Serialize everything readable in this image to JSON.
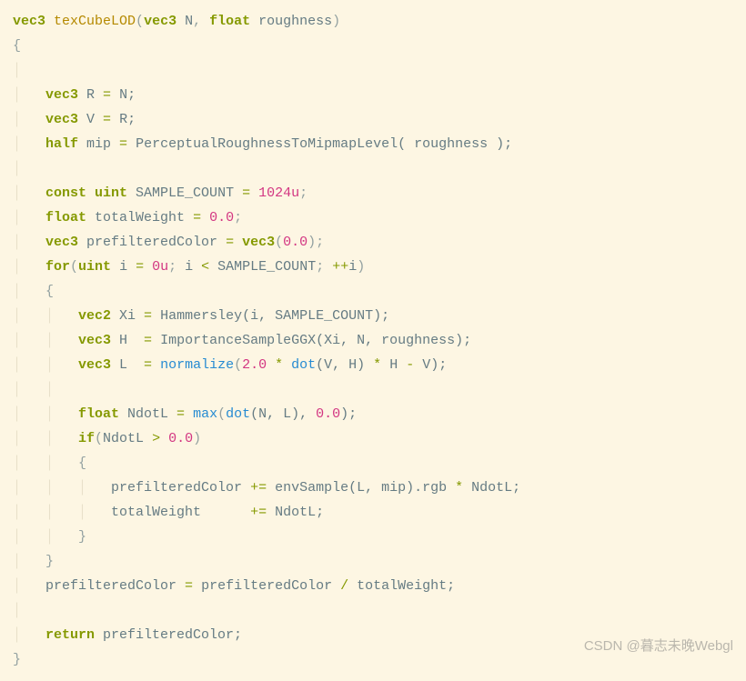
{
  "code": {
    "l1_kw1": "vec3",
    "l1_fn": "texCubeLOD",
    "l1_p1": "(",
    "l1_kw2": "vec3",
    "l1_id1": " N",
    "l1_c": ",",
    "l1_sp": " ",
    "l1_kw3": "float",
    "l1_id2": " roughness",
    "l1_p2": ")",
    "l2": "{",
    "l3_kw": "vec3",
    "l3_rest": " R ",
    "l3_eq": "=",
    "l3_rest2": " N;",
    "l4_kw": "vec3",
    "l4_rest": " V ",
    "l4_eq": "=",
    "l4_rest2": " R;",
    "l5_kw": "half",
    "l5_rest": " mip ",
    "l5_eq": "=",
    "l5_rest2": " PerceptualRoughnessToMipmapLevel( roughness );",
    "l6_kw1": "const",
    "l6_kw2": " uint",
    "l6_rest": " SAMPLE_COUNT ",
    "l6_eq": "=",
    "l6_sp": " ",
    "l6_num": "1024u",
    "l6_sc": ";",
    "l7_kw": "float",
    "l7_rest": " totalWeight ",
    "l7_eq": "=",
    "l7_sp": " ",
    "l7_num": "0.0",
    "l7_sc": ";",
    "l8_kw": "vec3",
    "l8_rest": " prefilteredColor ",
    "l8_eq": "=",
    "l8_sp": " ",
    "l8_kw2": "vec3",
    "l8_p1": "(",
    "l8_num": "0.0",
    "l8_p2": ")",
    "l8_sc": ";",
    "l9_kw1": "for",
    "l9_p1": "(",
    "l9_kw2": "uint",
    "l9_rest": " i ",
    "l9_eq": "=",
    "l9_sp": " ",
    "l9_num": "0u",
    "l9_sc": ";",
    "l9_rest2": " i ",
    "l9_lt": "<",
    "l9_rest3": " SAMPLE_COUNT",
    "l9_sc2": ";",
    "l9_sp2": " ",
    "l9_inc": "++",
    "l9_rest4": "i",
    "l9_p2": ")",
    "l10": "{",
    "l11_kw": "vec2",
    "l11_rest": " Xi ",
    "l11_eq": "=",
    "l11_rest2": " Hammersley(i, SAMPLE_COUNT);",
    "l12_kw": "vec3",
    "l12_rest": " H  ",
    "l12_eq": "=",
    "l12_rest2": " ImportanceSampleGGX(Xi, N, roughness);",
    "l13_kw": "vec3",
    "l13_rest": " L  ",
    "l13_eq": "=",
    "l13_sp": " ",
    "l13_fn": "normalize",
    "l13_p1": "(",
    "l13_num1": "2.0",
    "l13_op1": " * ",
    "l13_fn2": "dot",
    "l13_p2": "(V, H)",
    "l13_op2": " * ",
    "l13_rest2": "H ",
    "l13_minus": "-",
    "l13_rest3": " V);",
    "l14_kw": "float",
    "l14_rest": " NdotL ",
    "l14_eq": "=",
    "l14_sp": " ",
    "l14_fn": "max",
    "l14_p1": "(",
    "l14_fn2": "dot",
    "l14_p2": "(N, L), ",
    "l14_num": "0.0",
    "l14_p3": ");",
    "l15_kw": "if",
    "l15_p1": "(",
    "l15_rest": "NdotL ",
    "l15_gt": ">",
    "l15_sp": " ",
    "l15_num": "0.0",
    "l15_p2": ")",
    "l16": "{",
    "l17_rest": "prefilteredColor ",
    "l17_op": "+=",
    "l17_rest2": " envSample(L, mip).rgb ",
    "l17_op2": "*",
    "l17_rest3": " NdotL;",
    "l18_rest": "totalWeight      ",
    "l18_op": "+=",
    "l18_rest2": " NdotL;",
    "l19": "}",
    "l20": "}",
    "l21_rest": "prefilteredColor ",
    "l21_eq": "=",
    "l21_rest2": " prefilteredColor ",
    "l21_op": "/",
    "l21_rest3": " totalWeight;",
    "l22_kw": "return",
    "l22_rest": " prefilteredColor;",
    "l23": "}"
  },
  "watermark": "CSDN @暮志未晚Webgl"
}
